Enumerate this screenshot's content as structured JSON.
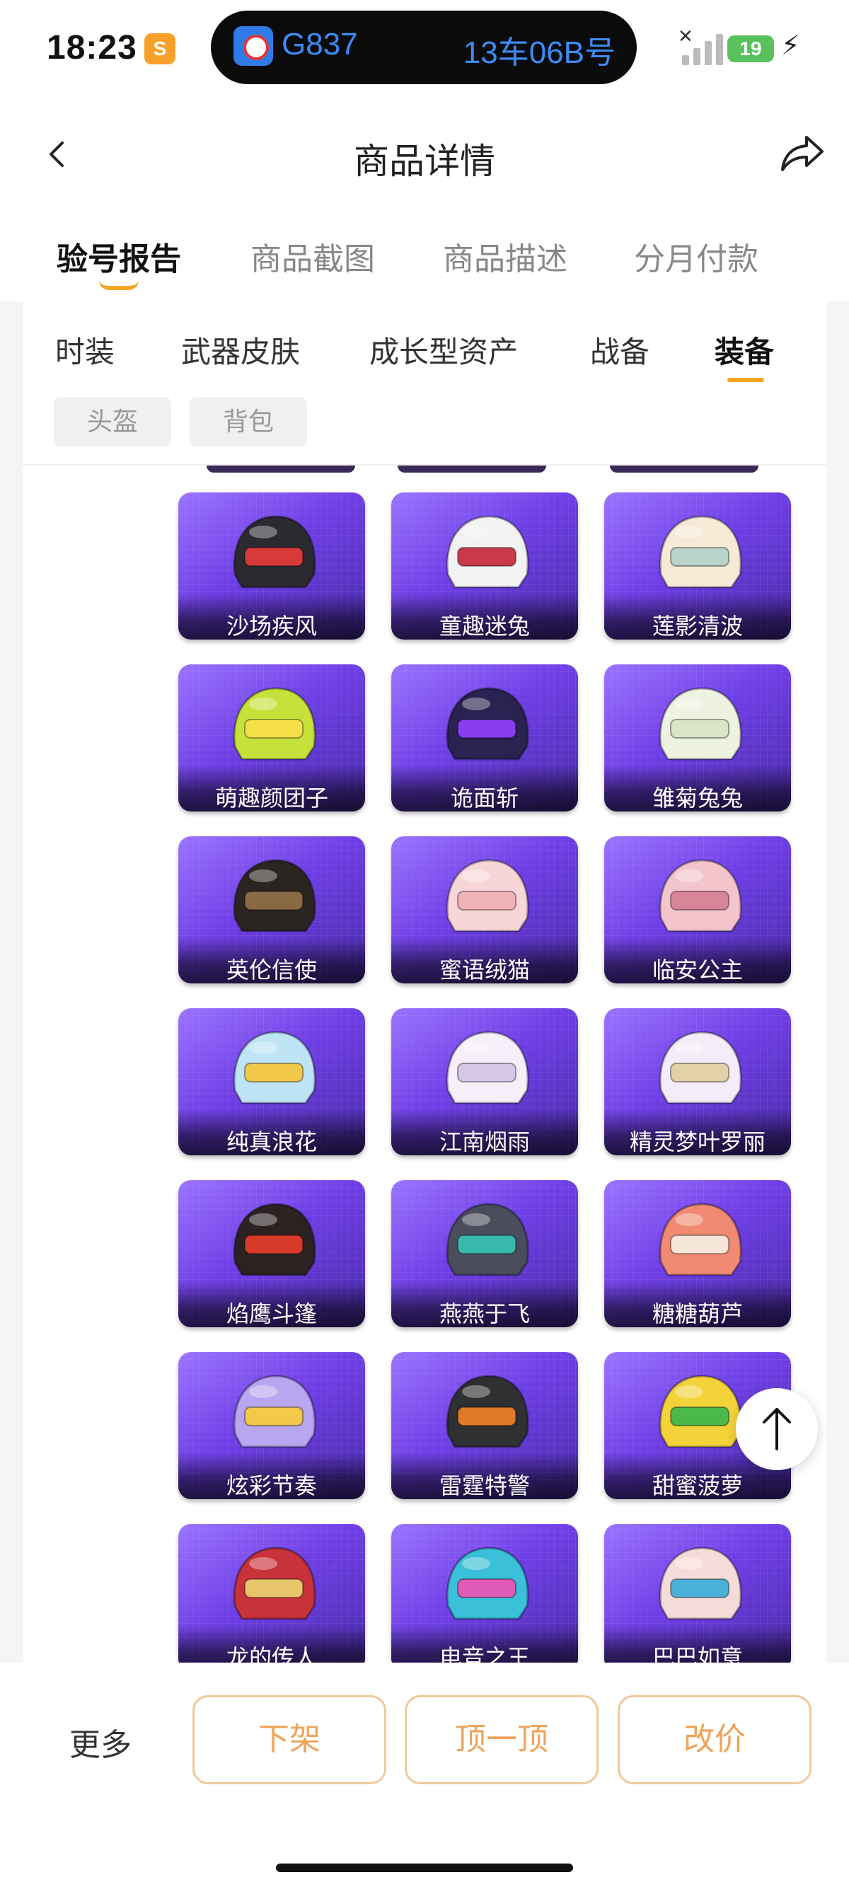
{
  "status_bar": {
    "time": "18:23",
    "app_badge": "S",
    "train_number": "G837",
    "seat": "13车06B号",
    "battery": "19",
    "battery_color": "#59c25f"
  },
  "header": {
    "title": "商品详情",
    "back_icon": "chevron-left-icon",
    "share_icon": "share-arrow-icon"
  },
  "main_tabs": [
    {
      "label": "验号报告",
      "active": true
    },
    {
      "label": "商品截图",
      "active": false
    },
    {
      "label": "商品描述",
      "active": false
    },
    {
      "label": "分月付款",
      "active": false
    }
  ],
  "sub_tabs": [
    {
      "label": "时装",
      "active": false
    },
    {
      "label": "武器皮肤",
      "active": false
    },
    {
      "label": "成长型资产",
      "active": false
    },
    {
      "label": "战备",
      "active": false
    },
    {
      "label": "装备",
      "active": true
    }
  ],
  "chips": [
    "头盔",
    "背包"
  ],
  "items": [
    {
      "name": "沙场疾风",
      "c1": "#2a2a30",
      "c2": "#d83a3a"
    },
    {
      "name": "童趣迷兔",
      "c1": "#f2f2f2",
      "c2": "#c83a4a"
    },
    {
      "name": "莲影清波",
      "c1": "#f4ead5",
      "c2": "#b9d3c8"
    },
    {
      "name": "萌趣颜团子",
      "c1": "#c6e23a",
      "c2": "#f5e04a"
    },
    {
      "name": "诡面斩",
      "c1": "#2a2250",
      "c2": "#8a3cf0"
    },
    {
      "name": "雏菊兔兔",
      "c1": "#eef2e0",
      "c2": "#d9e5c5"
    },
    {
      "name": "英伦信使",
      "c1": "#2b2522",
      "c2": "#8a6a45"
    },
    {
      "name": "蜜语绒猫",
      "c1": "#f8d6d8",
      "c2": "#f0b3b8"
    },
    {
      "name": "临安公主",
      "c1": "#f3c4cc",
      "c2": "#d8859a"
    },
    {
      "name": "纯真浪花",
      "c1": "#bfe4f5",
      "c2": "#f2c84a"
    },
    {
      "name": "江南烟雨",
      "c1": "#f6eef8",
      "c2": "#d8c6e8"
    },
    {
      "name": "精灵梦叶罗丽",
      "c1": "#f4ecf8",
      "c2": "#e3d2a8"
    },
    {
      "name": "焰鹰斗篷",
      "c1": "#2c2222",
      "c2": "#d83a2a"
    },
    {
      "name": "燕燕于飞",
      "c1": "#4a4e5c",
      "c2": "#3ab8b0"
    },
    {
      "name": "糖糖葫芦",
      "c1": "#f08a72",
      "c2": "#f6e6d8"
    },
    {
      "name": "炫彩节奏",
      "c1": "#b8a6f0",
      "c2": "#f2c94a"
    },
    {
      "name": "雷霆特警",
      "c1": "#2e3032",
      "c2": "#e07a2a"
    },
    {
      "name": "甜蜜菠萝",
      "c1": "#f3d23a",
      "c2": "#4ab84a"
    },
    {
      "name": "龙的传人",
      "c1": "#c8323a",
      "c2": "#e8c46a"
    },
    {
      "name": "电音之王",
      "c1": "#3ac0d8",
      "c2": "#e05ab8"
    },
    {
      "name": "巴巴如意",
      "c1": "#f6dcd8",
      "c2": "#4ab0d8"
    }
  ],
  "bottom_bar": {
    "more": "更多",
    "buttons": [
      "下架",
      "顶一顶",
      "改价"
    ],
    "accent": "#f0a35a"
  },
  "scroll_top_icon": "arrow-up-icon"
}
